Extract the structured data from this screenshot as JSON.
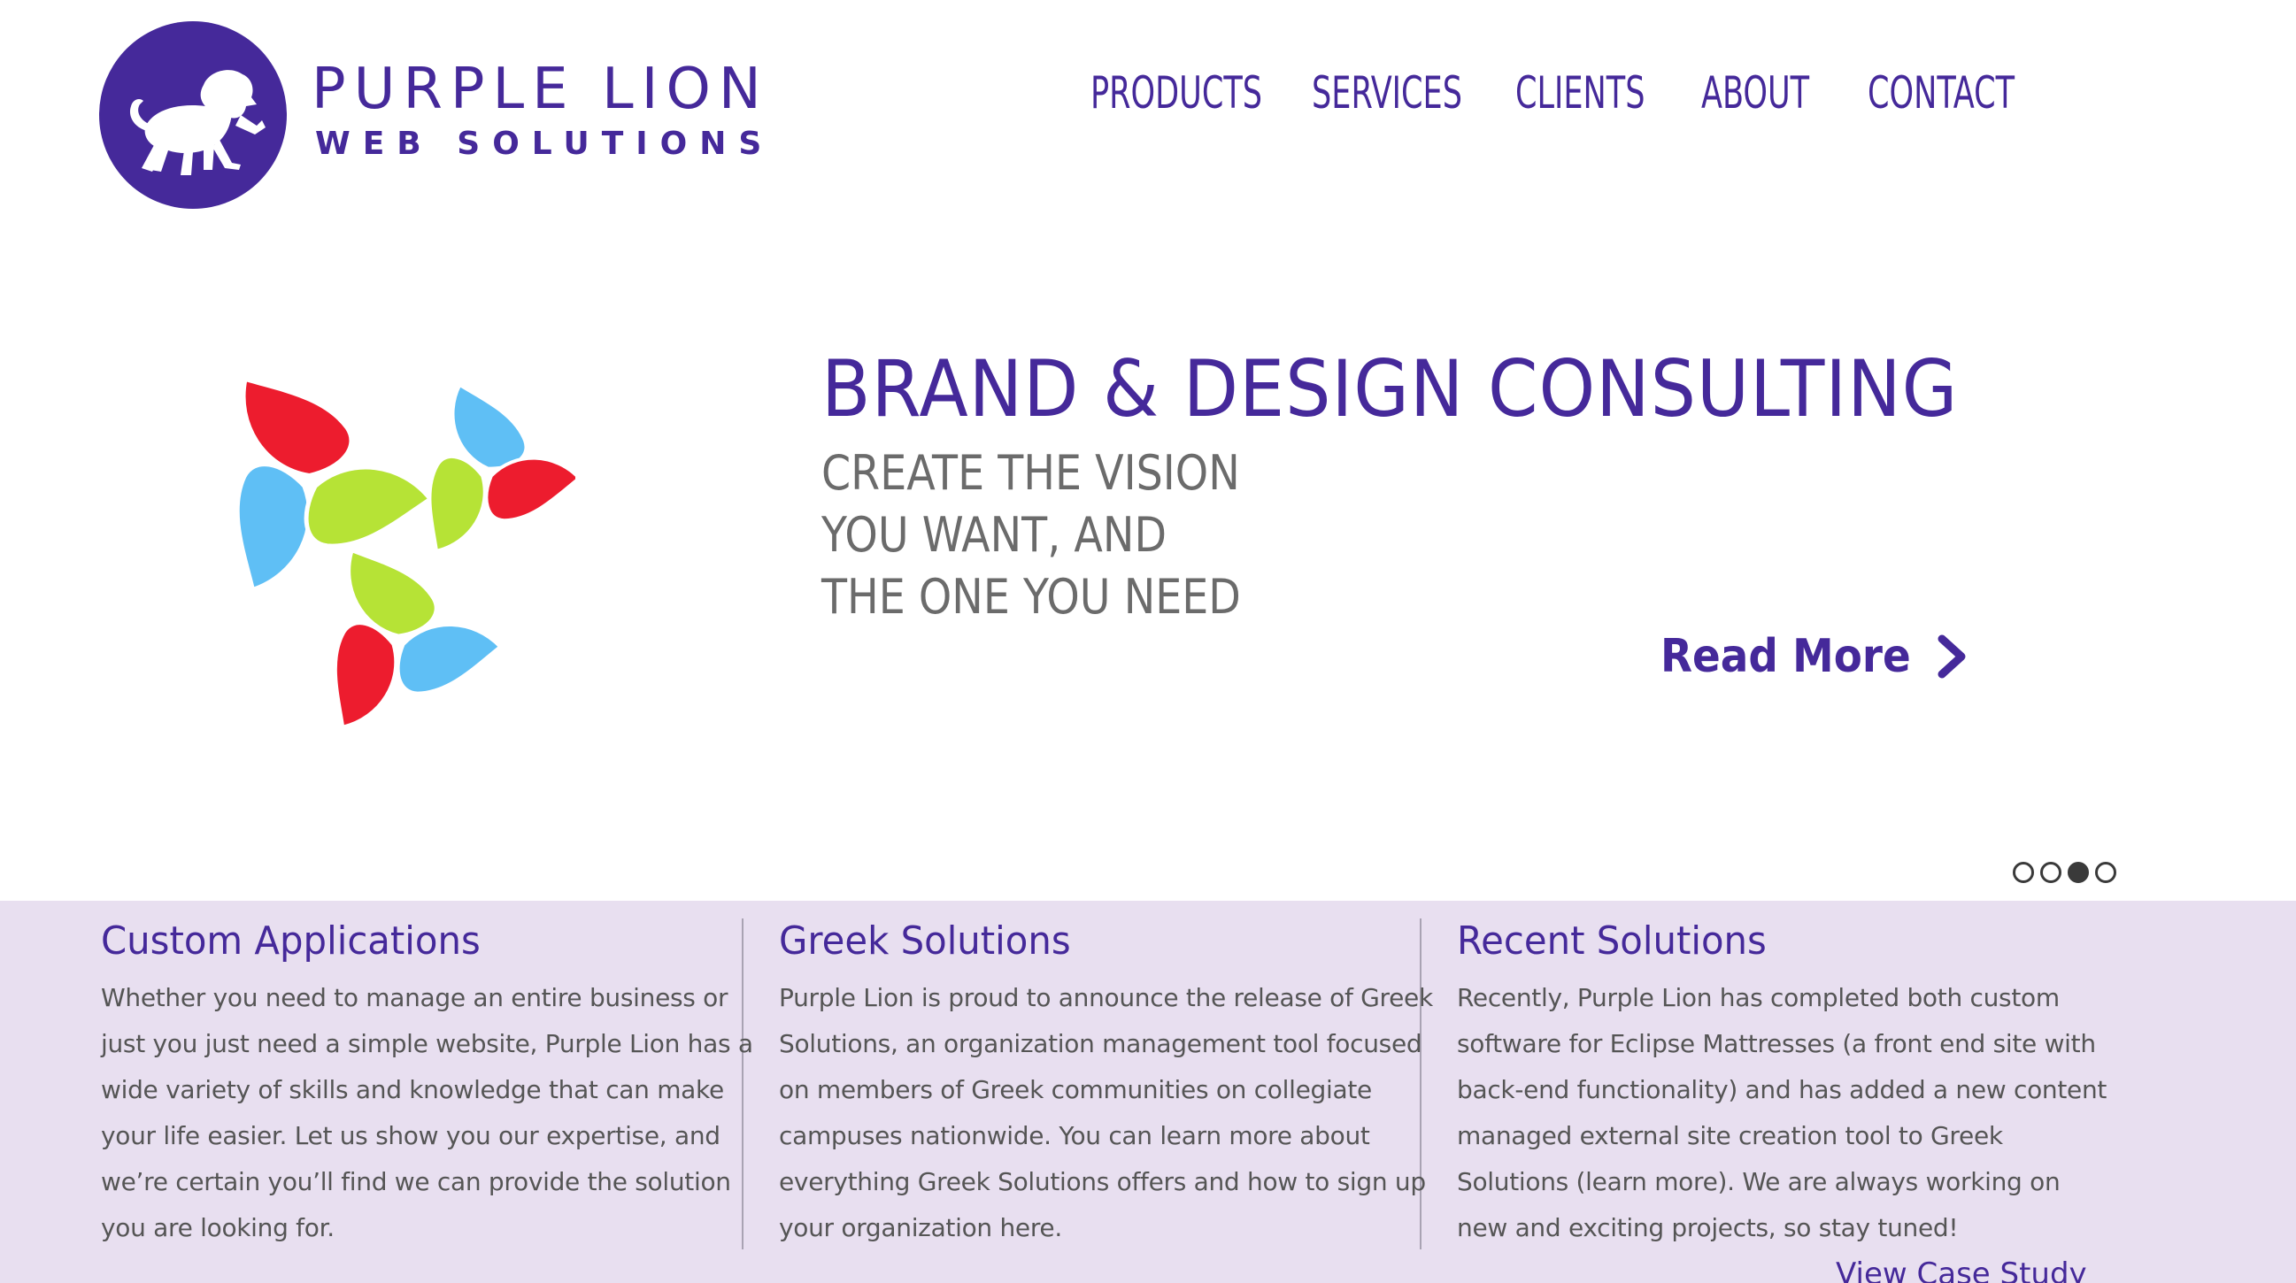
{
  "brand": {
    "name": "PURPLE LION",
    "tagline": "WEB SOLUTIONS",
    "primary_color": "#45299a"
  },
  "nav": {
    "items": [
      {
        "label": "PRODUCTS"
      },
      {
        "label": "SERVICES"
      },
      {
        "label": "CLIENTS"
      },
      {
        "label": "ABOUT"
      },
      {
        "label": "CONTACT"
      }
    ]
  },
  "hero": {
    "title": "BRAND & DESIGN CONSULTING",
    "subtitle": "CREATE THE VISION\nYOU WANT, AND\nTHE ONE YOU NEED",
    "read_more": "Read More",
    "art_colors": {
      "red": "#ed1c2e",
      "blue": "#5fbff5",
      "green": "#b6e336"
    },
    "slider": {
      "total": 4,
      "active_index": 2
    }
  },
  "columns": [
    {
      "title": "Custom Applications",
      "body": "Whether you need to manage an entire business or just you just need a simple website, Purple Lion has a wide variety of skills and knowledge that can make your life easier. Let us show you our expertise, and we’re certain you’ll find we can provide the solution you are looking for."
    },
    {
      "title": "Greek Solutions",
      "body": "Purple Lion is proud to announce the release of Greek Solutions, an organization management tool focused on members of Greek communities on collegiate campuses nationwide. You can learn more about everything Greek Solutions offers and how to sign up your organization here."
    },
    {
      "title": "Recent Solutions",
      "body": "Recently, Purple Lion has completed both custom software for Eclipse Mattresses (a front end site with back-end functionality) and has added a new content managed external site creation tool to Greek Solutions (learn more). We are always working on new and exciting projects, so stay tuned!",
      "link": "View Case Study"
    }
  ],
  "band_color": "#e8dff0"
}
